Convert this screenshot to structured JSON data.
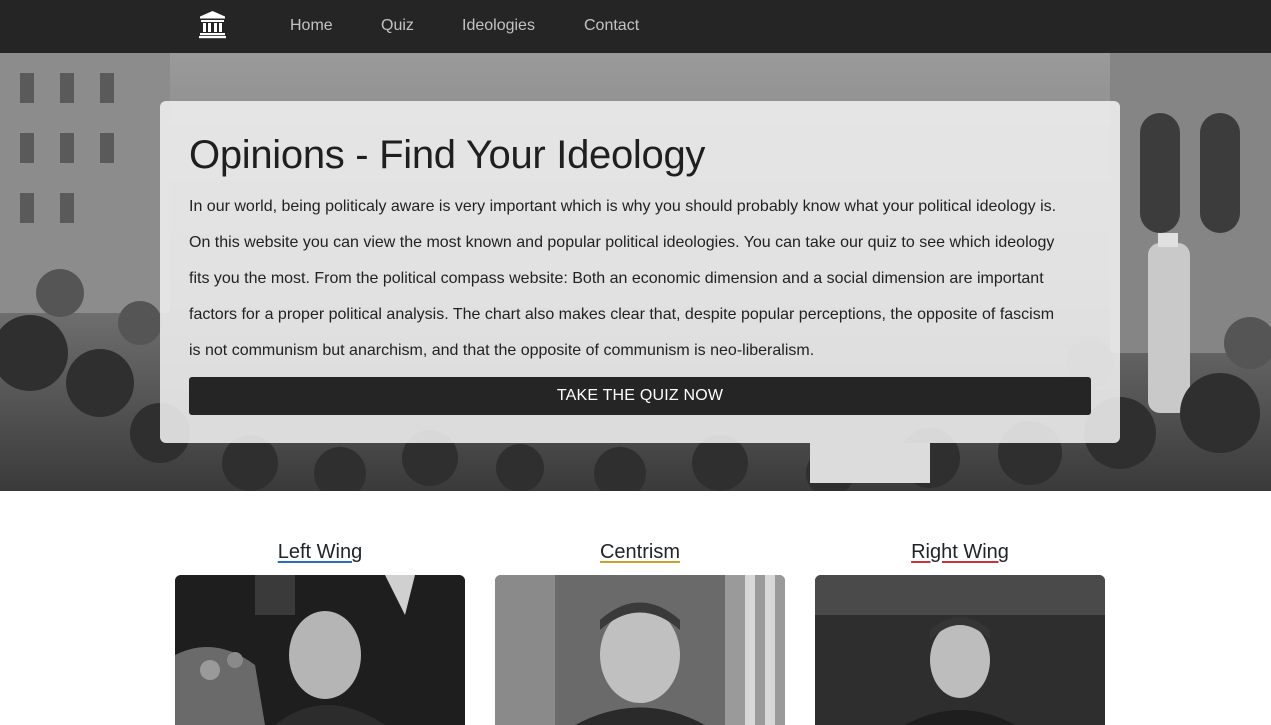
{
  "nav": {
    "brand_icon": "institution-building-icon",
    "links": [
      "Home",
      "Quiz",
      "Ideologies",
      "Contact"
    ]
  },
  "hero": {
    "title": "Opinions - Find Your Ideology",
    "lead_lines": [
      "In our world, being politicaly aware is very important which is why you should probably know what your political ideology is.",
      "On this website you can view the most known and popular political ideologies. You can take our quiz to see which ideology",
      "fits you the most. From the political compass website: Both an economic dimension and a social dimension are important",
      "factors for a proper political analysis. The chart also makes clear that, despite popular perceptions, the opposite of fascism",
      "is not communism but anarchism, and that the opposite of communism is neo-liberalism."
    ],
    "cta_label": "TAKE THE QUIZ NOW",
    "background": "grayscale-protest-crowd-photo"
  },
  "categories": [
    {
      "title": "Left Wing",
      "underline_color": "#2a6fb5",
      "photo": "grayscale-portrait-leader-left"
    },
    {
      "title": "Centrism",
      "underline_color": "#c9a227",
      "photo": "grayscale-portrait-leader-center"
    },
    {
      "title": "Right Wing",
      "underline_color": "#c8323a",
      "photo": "grayscale-portrait-leader-right"
    }
  ],
  "colors": {
    "navbar": "#252525",
    "button": "#252525",
    "card_bg": "#f0f0f0"
  }
}
